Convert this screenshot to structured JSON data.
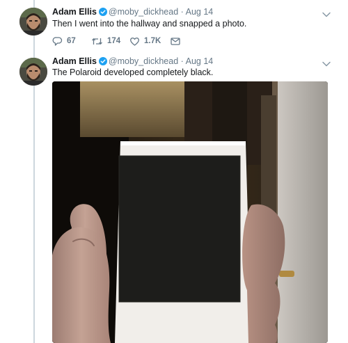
{
  "thread": {
    "tweets": [
      {
        "author": {
          "name": "Adam Ellis",
          "handle": "@moby_dickhead",
          "verified": true
        },
        "separator": "·",
        "time": "Aug 14",
        "text": "Then I went into the hallway and snapped a photo.",
        "stats": {
          "replies": "67",
          "retweets": "174",
          "likes": "1.7K"
        }
      },
      {
        "author": {
          "name": "Adam Ellis",
          "handle": "@moby_dickhead",
          "verified": true
        },
        "separator": "·",
        "time": "Aug 14",
        "text": "The Polaroid developed completely black."
      }
    ]
  },
  "colors": {
    "name": "#14171a",
    "meta": "#657786",
    "verified": "#1da1f2",
    "thread_line": "#ccd6dd"
  },
  "icons": [
    "avatar",
    "verified-badge-icon",
    "chevron-down-icon",
    "reply-icon",
    "retweet-icon",
    "like-icon",
    "direct-message-icon"
  ]
}
